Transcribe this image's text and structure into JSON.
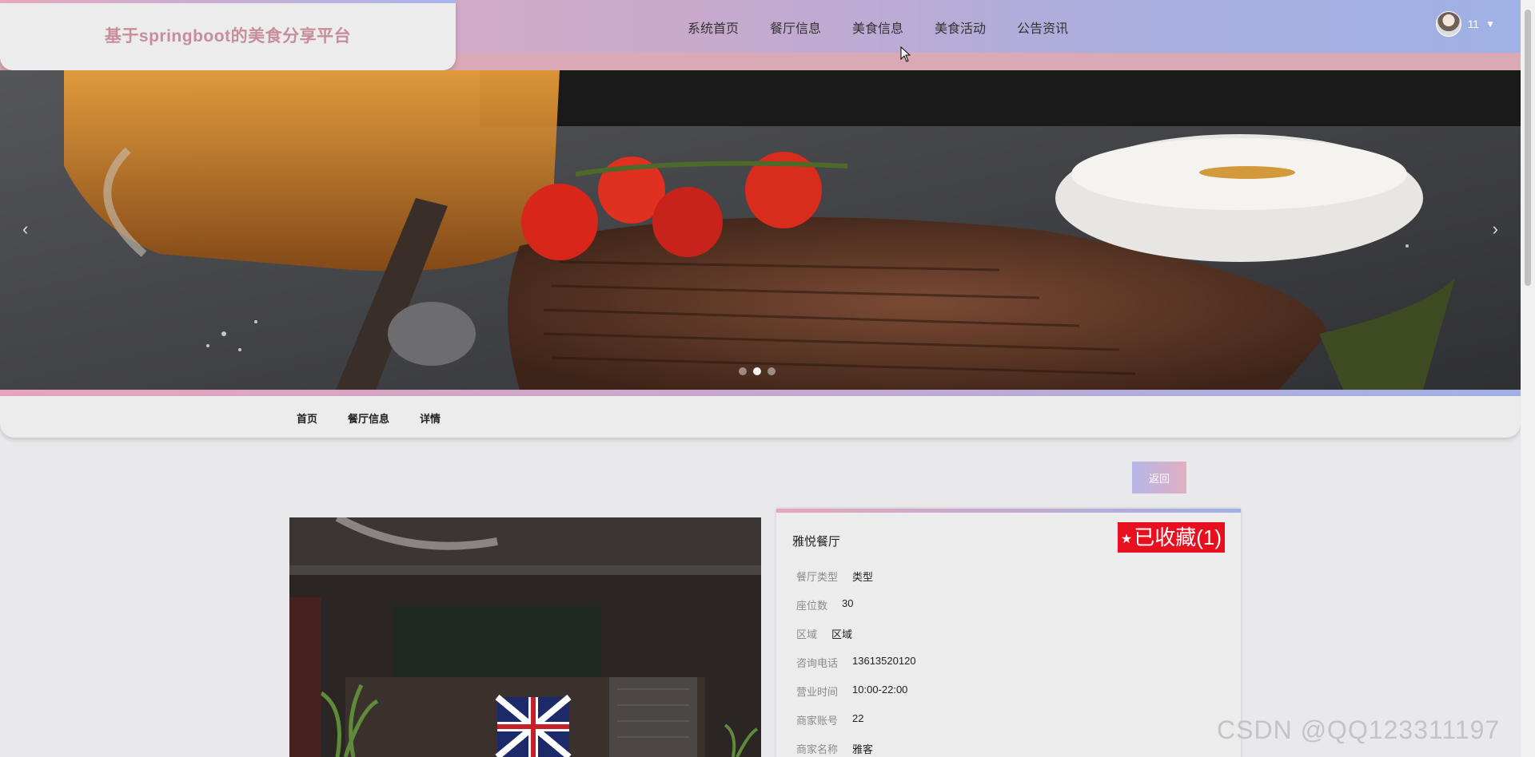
{
  "header": {
    "title": "基于springboot的美食分享平台",
    "nav": [
      "系统首页",
      "餐厅信息",
      "美食信息",
      "美食活动",
      "公告资讯"
    ],
    "username": "11"
  },
  "banner": {
    "prev_arrow": "‹",
    "next_arrow": "›",
    "slide_count": 3,
    "active_slide": 2
  },
  "breadcrumb": [
    "首页",
    "餐厅信息",
    "详情"
  ],
  "back_button": "返回",
  "restaurant": {
    "name": "雅悦餐厅",
    "favorite_label": "已收藏(1)",
    "fields": [
      {
        "label": "餐厅类型",
        "value": "类型"
      },
      {
        "label": "座位数",
        "value": "30"
      },
      {
        "label": "区域",
        "value": "区域"
      },
      {
        "label": "咨询电话",
        "value": "13613520120"
      },
      {
        "label": "营业时间",
        "value": "10:00-22:00"
      },
      {
        "label": "商家账号",
        "value": "22"
      },
      {
        "label": "商家名称",
        "value": "雅客"
      }
    ]
  },
  "watermark": "CSDN @QQ123311197",
  "colors": {
    "header_gradient_start": "#e0b0c4",
    "header_gradient_end": "#9fb1e6",
    "title_color": "#c78d9c",
    "favorite_bg": "#e8101e"
  },
  "icons": {
    "favorite": "star-icon",
    "user_menu": "caret-down-icon"
  }
}
